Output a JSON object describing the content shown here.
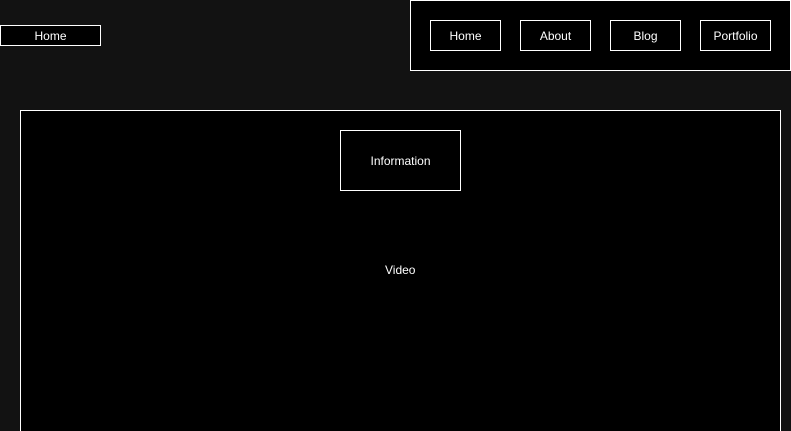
{
  "header": {
    "home_left_label": "Home"
  },
  "nav": {
    "items": [
      {
        "label": "Home"
      },
      {
        "label": "About"
      },
      {
        "label": "Blog"
      },
      {
        "label": "Portfolio"
      }
    ]
  },
  "main": {
    "info_label": "Information",
    "video_label": "Video"
  },
  "colors": {
    "background": "#121212",
    "panel": "#000000",
    "border": "#ffffff",
    "text": "#ffffff"
  }
}
